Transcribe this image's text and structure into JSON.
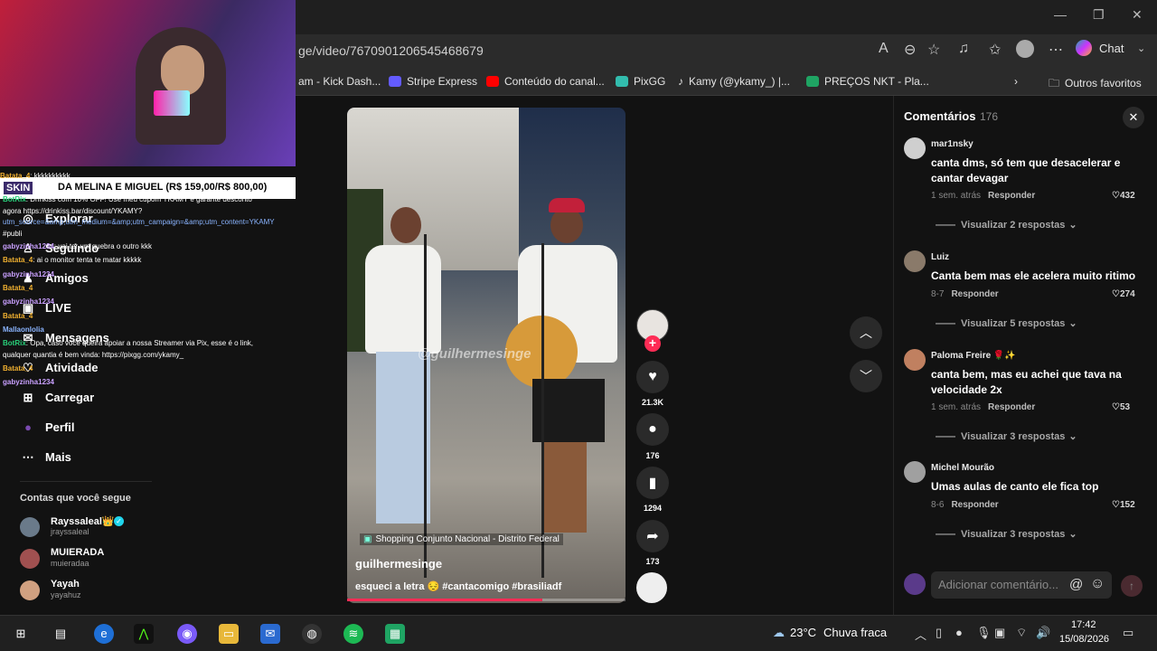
{
  "browser": {
    "url": "ge/video/7670901206545468679",
    "chat_label": "Chat",
    "favorites": [
      {
        "label": "am - Kick Dash...",
        "color": "#53fc18"
      },
      {
        "label": "Stripe Express",
        "color": "#635bff"
      },
      {
        "label": "Conteúdo do canal...",
        "color": "#ff0000"
      },
      {
        "label": "PixGG",
        "color": "#32bcad"
      },
      {
        "label": "Kamy (@ykamy_) |...",
        "color": "#000000"
      },
      {
        "label": "PREÇOS NKT - Pla...",
        "color": "#1fa463"
      }
    ],
    "other_favorites": "Outros favoritos"
  },
  "stream": {
    "skin_label": "SKIN",
    "skin_text": "DA MELINA E MIGUEL (R$ 159,00/R$ 800,00)",
    "chat": [
      {
        "user": "Batata_4",
        "color": "#f0b030",
        "text": ": kkkkkkkkkk"
      },
      {
        "user": "BotRix",
        "color": "#28d07a",
        "text": ": Drinkiss com 10% OFF! Use meu cupom YKAMY e garante desconto"
      },
      {
        "user": "",
        "color": "#ffffff",
        "text": "agora https://drinkiss.bar/discount/YKAMY?"
      },
      {
        "user": "",
        "color": "#8ab4ff",
        "text": "utm_source=&amp;utm_medium=&amp;utm_campaign=&amp;utm_content=YKAMY"
      },
      {
        "user": "",
        "color": "#ffffff",
        "text": "#publi"
      },
      {
        "user": "gabyzinha1234",
        "color": "#c9a0ff",
        "text": ": vai ter um quebra o outro kkk"
      },
      {
        "user": "Batata_4",
        "color": "#f0b030",
        "text": ": ai o monitor tenta te matar kkkkk"
      },
      {
        "user": "gabyzinha1234",
        "color": "#c9a0ff",
        "text": ""
      },
      {
        "user": "Batata_4",
        "color": "#f0b030",
        "text": ""
      },
      {
        "user": "gabyzinha1234",
        "color": "#c9a0ff",
        "text": ""
      },
      {
        "user": "Batata_4",
        "color": "#f0b030",
        "text": ""
      },
      {
        "user": "Mallaonlolia",
        "color": "#8ab4ff",
        "text": ""
      },
      {
        "user": "BotRix",
        "color": "#28d07a",
        "text": ": Opa, caso você queira apoiar a nossa Streamer via Pix, esse é o link,"
      },
      {
        "user": "",
        "color": "#ffffff",
        "text": "qualquer quantia é bem vinda: https://pixgg.com/ykamy_"
      },
      {
        "user": "Batata_4",
        "color": "#f0b030",
        "text": ""
      },
      {
        "user": "gabyzinha1234",
        "color": "#c9a0ff",
        "text": ""
      }
    ]
  },
  "sidebar": {
    "items": [
      {
        "label": "Explorar",
        "icon": "compass-icon",
        "glyph": "◎"
      },
      {
        "label": "Seguindo",
        "icon": "following-icon",
        "glyph": "♙"
      },
      {
        "label": "Amigos",
        "icon": "friends-icon",
        "glyph": "♟"
      },
      {
        "label": "LIVE",
        "icon": "live-icon",
        "glyph": "▣"
      },
      {
        "label": "Mensagens",
        "icon": "messages-icon",
        "glyph": "✉"
      },
      {
        "label": "Atividade",
        "icon": "activity-icon",
        "glyph": "♡"
      },
      {
        "label": "Carregar",
        "icon": "upload-icon",
        "glyph": "⊞"
      },
      {
        "label": "Perfil",
        "icon": "profile-icon",
        "glyph": "●"
      },
      {
        "label": "Mais",
        "icon": "more-icon",
        "glyph": "⋯"
      }
    ],
    "following_title": "Contas que você segue",
    "following": [
      {
        "name": "Rayssaleal👑",
        "handle": "jrayssaleal",
        "color": "#6a7a8a"
      },
      {
        "name": "MUIERADA",
        "handle": "muieradaa",
        "color": "#a05050"
      },
      {
        "name": "Yayah",
        "handle": "yayahuz",
        "color": "#d0a080"
      }
    ]
  },
  "video": {
    "watermark": "@guilhermesinge",
    "location": "Shopping Conjunto Nacional - Distrito Federal",
    "author": "guilhermesinge",
    "caption": "esqueci a letra 😔 #cantacomigo #brasiliadf",
    "progress": 0.7
  },
  "actions": {
    "likes": "21.3K",
    "comments": "176",
    "saves": "1294",
    "shares": "173"
  },
  "comments": {
    "title": "Comentários",
    "count": "176",
    "input_placeholder": "Adicionar comentário...",
    "reply_label": "Responder",
    "items": [
      {
        "user": "mar1nsky",
        "text": "canta dms, só tem que desacelerar e cantar devagar",
        "time": "1 sem. atrás",
        "likes": "432",
        "more": "Visualizar 2 respostas",
        "color": "#cfcfcf"
      },
      {
        "user": "Luiz",
        "text": "Canta bem mas ele acelera muito ritimo",
        "time": "8-7",
        "likes": "274",
        "more": "Visualizar 5 respostas",
        "color": "#8a7a6a"
      },
      {
        "user": "Paloma Freire 🌹✨",
        "text": "canta bem, mas eu achei que tava na velocidade 2x",
        "time": "1 sem. atrás",
        "likes": "53",
        "more": "Visualizar 3 respostas",
        "color": "#c08060"
      },
      {
        "user": "Michel Mourão",
        "text": "Umas aulas de canto ele fica top",
        "time": "8-6",
        "likes": "152",
        "more": "Visualizar 3 respostas",
        "color": "#a0a0a0"
      }
    ]
  },
  "taskbar": {
    "weather_temp": "23°C",
    "weather_desc": "Chuva fraca",
    "time": "17:42",
    "date": "15/08/2026"
  }
}
